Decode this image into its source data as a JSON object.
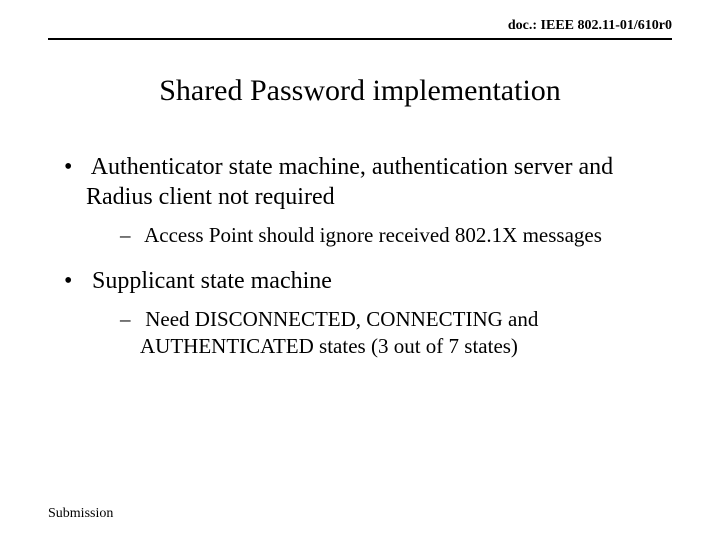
{
  "header": {
    "doc_id": "doc.: IEEE 802.11-01/610r0"
  },
  "title": "Shared Password implementation",
  "bullets": [
    {
      "text": "Authenticator state machine, authentication server and Radius client not required",
      "sub": [
        "Access Point should ignore received 802.1X messages"
      ]
    },
    {
      "text": "Supplicant state machine",
      "sub": [
        "Need DISCONNECTED, CONNECTING and AUTHENTICATED states (3 out of 7 states)"
      ]
    }
  ],
  "footer": {
    "label": "Submission"
  }
}
